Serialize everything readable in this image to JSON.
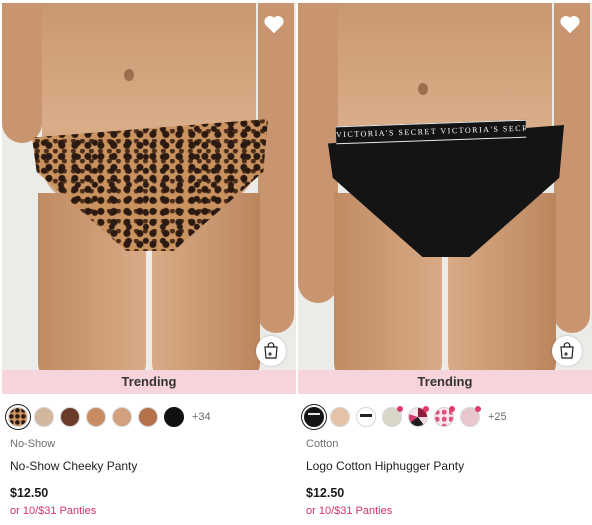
{
  "products": [
    {
      "category": "No-Show",
      "name": "No-Show Cheeky Panty",
      "badge": "Trending",
      "price": "$12.50",
      "promo": "or 10/$31 Panties",
      "more_colors": "+34",
      "swatches": [
        {
          "color": "#c9925f",
          "pattern": "leopard",
          "selected": true
        },
        {
          "color": "#d2b79f"
        },
        {
          "color": "#6a3a2a"
        },
        {
          "color": "#c98c62"
        },
        {
          "color": "#d1a07c"
        },
        {
          "color": "#b5714a"
        },
        {
          "color": "#111111"
        }
      ]
    },
    {
      "category": "Cotton",
      "name": "Logo Cotton Hiphugger Panty",
      "badge": "Trending",
      "price": "$12.50",
      "promo": "or 10/$31 Panties",
      "more_colors": "+25",
      "waistband_text": "VICTORIA'S SECRET    VICTORIA'S SECRET",
      "swatches": [
        {
          "color": "#151515",
          "pattern": "blackband",
          "selected": true
        },
        {
          "color": "#e6c3a8"
        },
        {
          "color": "#ffffff",
          "pattern": "logo"
        },
        {
          "color": "#d9d8c8",
          "new": true
        },
        {
          "color": "#8e1c3c",
          "pattern": "camo",
          "new": true
        },
        {
          "color": "#fbe6ee",
          "pattern": "pinkprint",
          "new": true
        },
        {
          "color": "#e8c8cc",
          "new": true
        }
      ]
    }
  ],
  "icons": {
    "favorite": "heart-outline-icon",
    "add_to_bag": "shopping-bag-plus-icon"
  },
  "colors": {
    "badge_bg": "#f7d4dc",
    "promo": "#d6336a",
    "new_dot": "#e03b6b"
  }
}
